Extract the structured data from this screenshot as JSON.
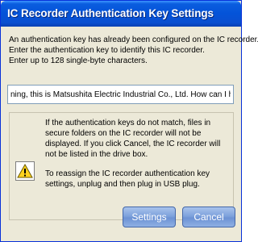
{
  "window": {
    "title": "IC Recorder Authentication Key Settings"
  },
  "intro": {
    "line1": "An authentication key has already been configured on the IC recorder.",
    "line2": "Enter the authentication key to identify this IC recorder.",
    "line3": "Enter up to 128 single-byte characters."
  },
  "key_field": {
    "value": "ning, this is Matsushita Electric Industrial Co., Ltd. How can I help you?"
  },
  "warning": {
    "icon": "warning-icon",
    "paragraph1": "If the authentication keys do not match, files in secure folders on the IC recorder will not be displayed.  If you click Cancel, the IC recorder will not be listed in the drive box.",
    "paragraph2": "To reassign the IC recorder authentication key settings, unplug and then plug in USB plug."
  },
  "buttons": {
    "settings": "Settings",
    "cancel": "Cancel"
  },
  "colors": {
    "titlebar": "#0453d8",
    "dialog_bg": "#ece9d8",
    "button": "#7ea2dc",
    "warning_yellow": "#ffd21f"
  }
}
